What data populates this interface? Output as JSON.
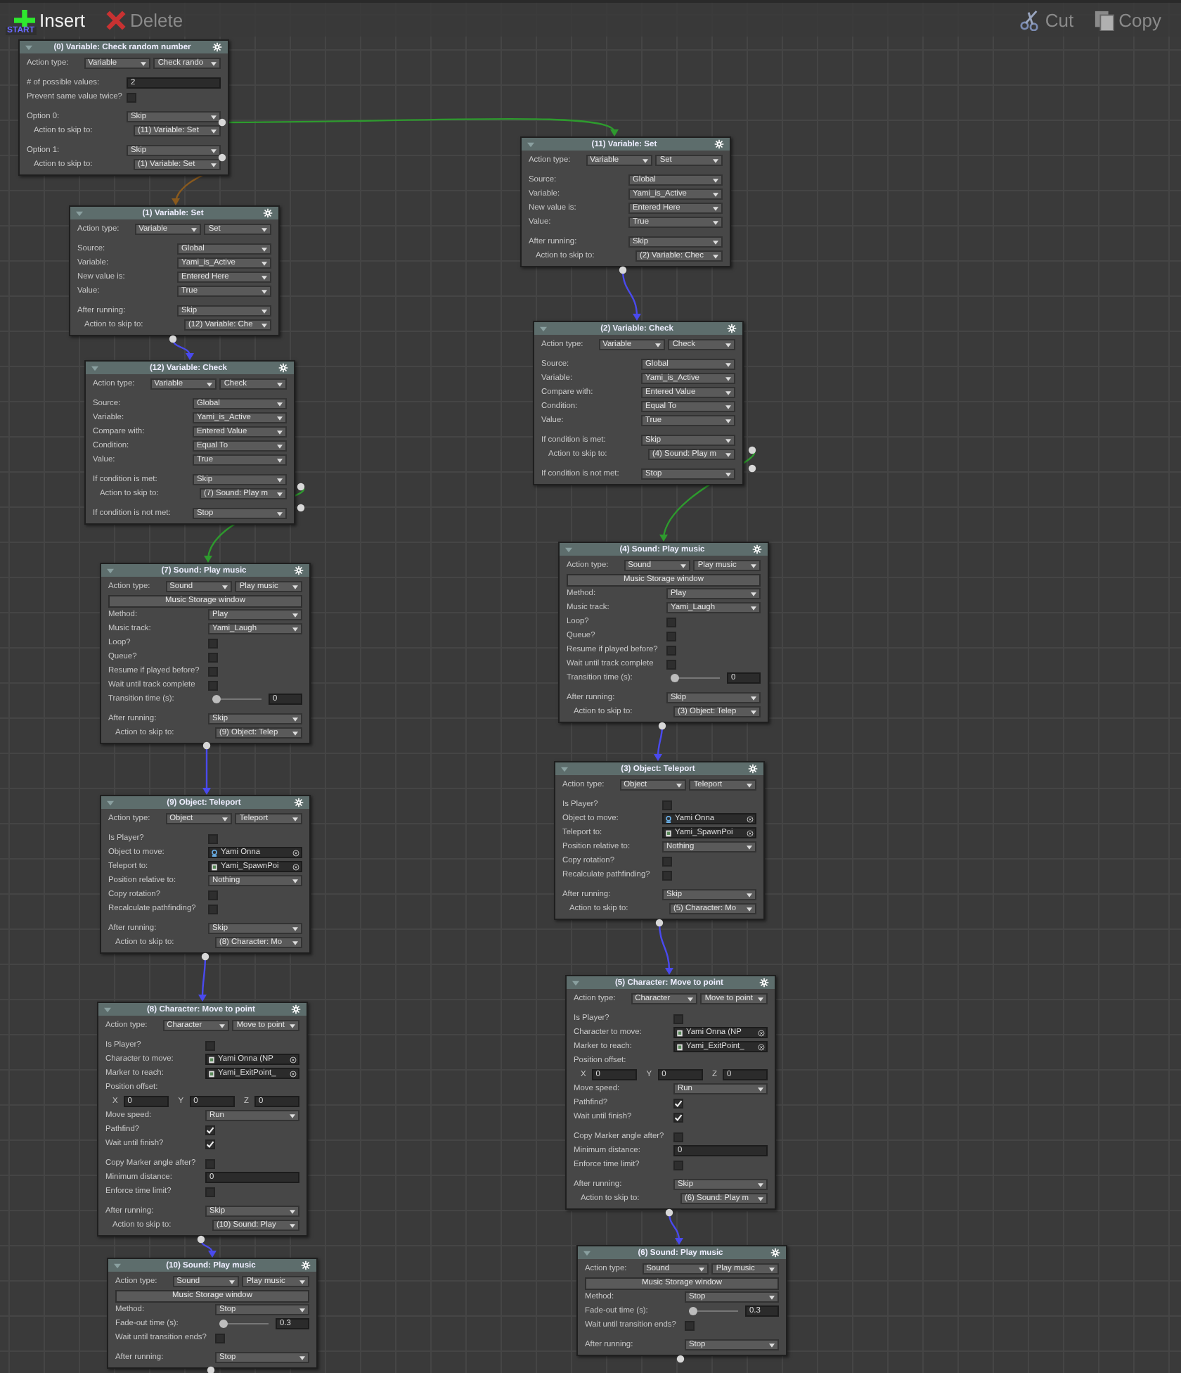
{
  "toolbar": {
    "left": [
      {
        "kind": "insert",
        "label": "Insert",
        "disabled": false
      },
      {
        "kind": "delete",
        "label": "Delete",
        "disabled": true
      }
    ],
    "right": [
      {
        "kind": "cut",
        "label": "Cut",
        "disabled": true
      },
      {
        "kind": "copy",
        "label": "Copy",
        "disabled": true
      }
    ]
  },
  "start_label": "START",
  "nodes": [
    {
      "title": "(0) Variable: Check random number",
      "sections": [
        [
          {
            "kind": "pair",
            "label": "Action type:",
            "values": [
              "Variable",
              "Check rando"
            ]
          }
        ],
        [
          {
            "kind": "text",
            "label": "# of possible values:",
            "value": "2"
          },
          {
            "kind": "check",
            "label": "Prevent same value twice?",
            "checked": false
          }
        ],
        [
          {
            "kind": "select",
            "label": "Option 0:",
            "value": "Skip"
          },
          {
            "kind": "sub",
            "label": "Action to skip to:",
            "value": "(11) Variable: Set"
          }
        ],
        [
          {
            "kind": "select",
            "label": "Option 1:",
            "value": "Skip"
          },
          {
            "kind": "sub",
            "label": "Action to skip to:",
            "value": "(1) Variable: Set"
          }
        ]
      ]
    },
    {
      "title": "(11) Variable: Set",
      "sections": [
        [
          {
            "kind": "pair",
            "label": "Action type:",
            "values": [
              "Variable",
              "Set"
            ]
          }
        ],
        [
          {
            "kind": "select",
            "label": "Source:",
            "value": "Global"
          },
          {
            "kind": "select",
            "label": "Variable:",
            "value": "Yami_is_Active"
          },
          {
            "kind": "select",
            "label": "New value is:",
            "value": "Entered Here"
          },
          {
            "kind": "select",
            "label": "Value:",
            "value": "True"
          }
        ],
        [
          {
            "kind": "select",
            "label": "After running:",
            "value": "Skip"
          },
          {
            "kind": "sub",
            "label": "Action to skip to:",
            "value": "(2) Variable: Chec"
          }
        ]
      ]
    },
    {
      "title": "(1) Variable: Set",
      "sections": [
        [
          {
            "kind": "pair",
            "label": "Action type:",
            "values": [
              "Variable",
              "Set"
            ]
          }
        ],
        [
          {
            "kind": "select",
            "label": "Source:",
            "value": "Global"
          },
          {
            "kind": "select",
            "label": "Variable:",
            "value": "Yami_is_Active"
          },
          {
            "kind": "select",
            "label": "New value is:",
            "value": "Entered Here"
          },
          {
            "kind": "select",
            "label": "Value:",
            "value": "True"
          }
        ],
        [
          {
            "kind": "select",
            "label": "After running:",
            "value": "Skip"
          },
          {
            "kind": "sub",
            "label": "Action to skip to:",
            "value": "(12) Variable: Che"
          }
        ]
      ]
    },
    {
      "title": "(2) Variable: Check",
      "sections": [
        [
          {
            "kind": "pair",
            "label": "Action type:",
            "values": [
              "Variable",
              "Check"
            ]
          }
        ],
        [
          {
            "kind": "select",
            "label": "Source:",
            "value": "Global"
          },
          {
            "kind": "select",
            "label": "Variable:",
            "value": "Yami_is_Active"
          },
          {
            "kind": "select",
            "label": "Compare with:",
            "value": "Entered Value"
          },
          {
            "kind": "select",
            "label": "Condition:",
            "value": "Equal To"
          },
          {
            "kind": "select",
            "label": "Value:",
            "value": "True"
          }
        ],
        [
          {
            "kind": "select",
            "label": "If condition is met:",
            "value": "Skip"
          },
          {
            "kind": "sub",
            "label": "Action to skip to:",
            "value": "(4) Sound: Play m"
          }
        ],
        [
          {
            "kind": "select",
            "label": "If condition is not met:",
            "value": "Stop"
          }
        ]
      ]
    },
    {
      "title": "(12) Variable: Check",
      "sections": [
        [
          {
            "kind": "pair",
            "label": "Action type:",
            "values": [
              "Variable",
              "Check"
            ]
          }
        ],
        [
          {
            "kind": "select",
            "label": "Source:",
            "value": "Global"
          },
          {
            "kind": "select",
            "label": "Variable:",
            "value": "Yami_is_Active"
          },
          {
            "kind": "select",
            "label": "Compare with:",
            "value": "Entered Value"
          },
          {
            "kind": "select",
            "label": "Condition:",
            "value": "Equal To"
          },
          {
            "kind": "select",
            "label": "Value:",
            "value": "True"
          }
        ],
        [
          {
            "kind": "select",
            "label": "If condition is met:",
            "value": "Skip"
          },
          {
            "kind": "sub",
            "label": "Action to skip to:",
            "value": "(7) Sound: Play m"
          }
        ],
        [
          {
            "kind": "select",
            "label": "If condition is not met:",
            "value": "Stop"
          }
        ]
      ]
    },
    {
      "title": "(4) Sound: Play music",
      "sections": [
        [
          {
            "kind": "pair",
            "label": "Action type:",
            "values": [
              "Sound",
              "Play music"
            ]
          },
          {
            "kind": "button",
            "label": "Music Storage window"
          },
          {
            "kind": "select",
            "label": "Method:",
            "value": "Play"
          },
          {
            "kind": "select",
            "label": "Music track:",
            "value": "Yami_Laugh"
          },
          {
            "kind": "check",
            "label": "Loop?",
            "checked": false
          },
          {
            "kind": "check",
            "label": "Queue?",
            "checked": false
          },
          {
            "kind": "check",
            "label": "Resume if played before?",
            "checked": false
          },
          {
            "kind": "check",
            "label": "Wait until track complete",
            "checked": false
          },
          {
            "kind": "slider",
            "label": "Transition time (s):",
            "level": 0,
            "value": "0"
          }
        ],
        [
          {
            "kind": "select",
            "label": "After running:",
            "value": "Skip"
          },
          {
            "kind": "sub",
            "label": "Action to skip to:",
            "value": "(3) Object: Telep"
          }
        ]
      ]
    },
    {
      "title": "(7) Sound: Play music",
      "sections": [
        [
          {
            "kind": "pair",
            "label": "Action type:",
            "values": [
              "Sound",
              "Play music"
            ]
          },
          {
            "kind": "button",
            "label": "Music Storage window"
          },
          {
            "kind": "select",
            "label": "Method:",
            "value": "Play"
          },
          {
            "kind": "select",
            "label": "Music track:",
            "value": "Yami_Laugh"
          },
          {
            "kind": "check",
            "label": "Loop?",
            "checked": false
          },
          {
            "kind": "check",
            "label": "Queue?",
            "checked": false
          },
          {
            "kind": "check",
            "label": "Resume if played before?",
            "checked": false
          },
          {
            "kind": "check",
            "label": "Wait until track complete",
            "checked": false
          },
          {
            "kind": "slider",
            "label": "Transition time (s):",
            "level": 0,
            "value": "0"
          }
        ],
        [
          {
            "kind": "select",
            "label": "After running:",
            "value": "Skip"
          },
          {
            "kind": "sub",
            "label": "Action to skip to:",
            "value": "(9) Object: Telep"
          }
        ]
      ]
    },
    {
      "title": "(3) Object: Teleport",
      "sections": [
        [
          {
            "kind": "pair",
            "label": "Action type:",
            "values": [
              "Object",
              "Teleport"
            ]
          }
        ],
        [
          {
            "kind": "check",
            "label": "Is Player?",
            "checked": false
          },
          {
            "kind": "actor",
            "label": "Object to move:",
            "value": "Yami Onna"
          },
          {
            "kind": "asset",
            "label": "Teleport to:",
            "value": "Yami_SpawnPoi"
          },
          {
            "kind": "select",
            "label": "Position relative to:",
            "value": "Nothing"
          },
          {
            "kind": "check",
            "label": "Copy rotation?",
            "checked": false
          },
          {
            "kind": "check",
            "label": "Recalculate pathfinding?",
            "checked": false
          }
        ],
        [
          {
            "kind": "select",
            "label": "After running:",
            "value": "Skip"
          },
          {
            "kind": "sub",
            "label": "Action to skip to:",
            "value": "(5) Character: Mo"
          }
        ]
      ]
    },
    {
      "title": "(9) Object: Teleport",
      "sections": [
        [
          {
            "kind": "pair",
            "label": "Action type:",
            "values": [
              "Object",
              "Teleport"
            ]
          }
        ],
        [
          {
            "kind": "check",
            "label": "Is Player?",
            "checked": false
          },
          {
            "kind": "actor",
            "label": "Object to move:",
            "value": "Yami Onna"
          },
          {
            "kind": "asset",
            "label": "Teleport to:",
            "value": "Yami_SpawnPoi"
          },
          {
            "kind": "select",
            "label": "Position relative to:",
            "value": "Nothing"
          },
          {
            "kind": "check",
            "label": "Copy rotation?",
            "checked": false
          },
          {
            "kind": "check",
            "label": "Recalculate pathfinding?",
            "checked": false
          }
        ],
        [
          {
            "kind": "select",
            "label": "After running:",
            "value": "Skip"
          },
          {
            "kind": "sub",
            "label": "Action to skip to:",
            "value": "(8) Character: Mo"
          }
        ]
      ]
    },
    {
      "title": "(5) Character: Move to point",
      "sections": [
        [
          {
            "kind": "pair",
            "label": "Action type:",
            "values": [
              "Character",
              "Move to point"
            ]
          }
        ],
        [
          {
            "kind": "check",
            "label": "Is Player?",
            "checked": false
          },
          {
            "kind": "asset",
            "label": "Character to move:",
            "value": "Yami Onna (NP"
          },
          {
            "kind": "asset",
            "label": "Marker to reach:",
            "value": "Yami_ExitPoint_"
          },
          {
            "kind": "label",
            "label": "Position offset:"
          },
          {
            "kind": "offset",
            "fields": [
              {
                "axis": "X",
                "value": "0"
              },
              {
                "axis": "Y",
                "value": "0"
              },
              {
                "axis": "Z",
                "value": "0"
              }
            ]
          },
          {
            "kind": "select",
            "label": "Move speed:",
            "value": "Run"
          },
          {
            "kind": "check",
            "label": "Pathfind?",
            "checked": true
          },
          {
            "kind": "check",
            "label": "Wait until finish?",
            "checked": true
          }
        ],
        [
          {
            "kind": "check",
            "label": "Copy Marker angle after?",
            "checked": false
          },
          {
            "kind": "text",
            "label": "Minimum distance:",
            "value": "0"
          },
          {
            "kind": "check",
            "label": "Enforce time limit?",
            "checked": false
          }
        ],
        [
          {
            "kind": "select",
            "label": "After running:",
            "value": "Skip"
          },
          {
            "kind": "sub",
            "label": "Action to skip to:",
            "value": "(6) Sound: Play m"
          }
        ]
      ]
    },
    {
      "title": "(8) Character: Move to point",
      "sections": [
        [
          {
            "kind": "pair",
            "label": "Action type:",
            "values": [
              "Character",
              "Move to point"
            ]
          }
        ],
        [
          {
            "kind": "check",
            "label": "Is Player?",
            "checked": false
          },
          {
            "kind": "asset",
            "label": "Character to move:",
            "value": "Yami Onna (NP"
          },
          {
            "kind": "asset",
            "label": "Marker to reach:",
            "value": "Yami_ExitPoint_"
          },
          {
            "kind": "label",
            "label": "Position offset:"
          },
          {
            "kind": "offset",
            "fields": [
              {
                "axis": "X",
                "value": "0"
              },
              {
                "axis": "Y",
                "value": "0"
              },
              {
                "axis": "Z",
                "value": "0"
              }
            ]
          },
          {
            "kind": "select",
            "label": "Move speed:",
            "value": "Run"
          },
          {
            "kind": "check",
            "label": "Pathfind?",
            "checked": true
          },
          {
            "kind": "check",
            "label": "Wait until finish?",
            "checked": true
          }
        ],
        [
          {
            "kind": "check",
            "label": "Copy Marker angle after?",
            "checked": false
          },
          {
            "kind": "text",
            "label": "Minimum distance:",
            "value": "0"
          },
          {
            "kind": "check",
            "label": "Enforce time limit?",
            "checked": false
          }
        ],
        [
          {
            "kind": "select",
            "label": "After running:",
            "value": "Skip"
          },
          {
            "kind": "sub",
            "label": "Action to skip to:",
            "value": "(10) Sound: Play"
          }
        ]
      ]
    },
    {
      "title": "(6) Sound: Play music",
      "sections": [
        [
          {
            "kind": "pair",
            "label": "Action type:",
            "values": [
              "Sound",
              "Play music"
            ]
          },
          {
            "kind": "button",
            "label": "Music Storage window"
          },
          {
            "kind": "select",
            "label": "Method:",
            "value": "Stop"
          },
          {
            "kind": "slider",
            "label": "Fade-out time (s):",
            "level": 0,
            "value": "0.3"
          },
          {
            "kind": "check",
            "label": "Wait until transition ends?",
            "checked": false
          }
        ],
        [
          {
            "kind": "select",
            "label": "After running:",
            "value": "Stop"
          }
        ]
      ]
    },
    {
      "title": "(10) Sound: Play music",
      "sections": [
        [
          {
            "kind": "pair",
            "label": "Action type:",
            "values": [
              "Sound",
              "Play music"
            ]
          },
          {
            "kind": "button",
            "label": "Music Storage window"
          },
          {
            "kind": "select",
            "label": "Method:",
            "value": "Stop"
          },
          {
            "kind": "slider",
            "label": "Fade-out time (s):",
            "level": 0,
            "value": "0.3"
          },
          {
            "kind": "check",
            "label": "Wait until transition ends?",
            "checked": false
          }
        ],
        [
          {
            "kind": "select",
            "label": "After running:",
            "value": "Stop"
          }
        ]
      ]
    }
  ]
}
